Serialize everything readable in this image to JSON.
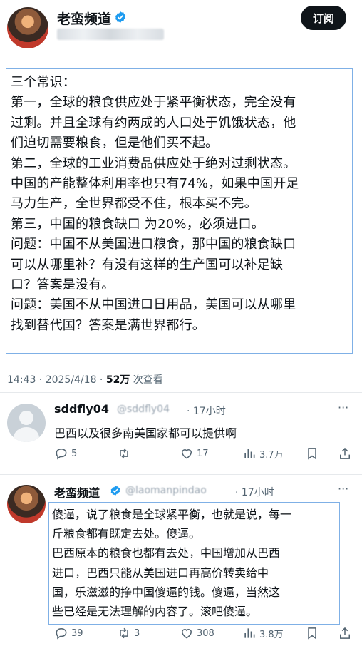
{
  "post": {
    "author_name": "老蛮频道",
    "subscribe_label": "订阅",
    "lines": [
      "三个常识：",
      "第一，全球的粮食供应处于紧平衡状态，完全没有",
      "过剩。并且全球有约两成的人口处于饥饿状态，他",
      "们迫切需要粮食，但是他们买不起。",
      "第二，全球的工业消费品供应处于绝对过剩状态。",
      "中国的产能整体利用率也只有74%，如果中国开足",
      "马力生产，全世界都受不住，根本买不完。",
      "第三，中国的粮食缺口 为20%，必须进口。",
      "问题：中国不从美国进口粮食，那中国的粮食缺口",
      "可以从哪里补？有没有这样的生产国可以补足缺",
      "口？答案是没有。",
      "问题：美国不从中国进口日用品，美国可以从哪里",
      "找到替代国？答案是满世界都行。"
    ],
    "time": "14:43 · 2025/4/18 · ",
    "views": "52万",
    "views_suffix": " 次查看"
  },
  "replies": [
    {
      "name": "sddfly04",
      "handle": "@sddfly04",
      "time": "· 17小时",
      "text": "巴西以及很多南美国家都可以提供啊",
      "stats": {
        "replies": "5",
        "retweets": "",
        "likes": "17",
        "views": "3.7万"
      }
    },
    {
      "name": "老蛮频道",
      "handle": "@laomanpindao",
      "time": "· 17小时",
      "lines": [
        "傻逼，说了粮食是全球紧平衡，也就是说，每一",
        "斤粮食都有既定去处。傻逼。",
        "巴西原本的粮食也都有去处，中国增加从巴西",
        "进口，巴西只能从美国进口再高价转卖给中",
        "国，乐滋滋的挣中国傻逼的钱。傻逼，当然这",
        "些已经是无法理解的内容了。滚吧傻逼。"
      ],
      "stats": {
        "replies": "39",
        "retweets": "3",
        "likes": "308",
        "views": "3.8万"
      }
    }
  ],
  "colors": {
    "verified": "#1d9bf0",
    "highlight_box": "#7fb0e6",
    "secondary_text": "#536471"
  },
  "icons": [
    "verified-badge-icon",
    "more-icon",
    "reply-icon",
    "retweet-icon",
    "like-icon",
    "views-icon",
    "bookmark-icon",
    "share-icon"
  ]
}
